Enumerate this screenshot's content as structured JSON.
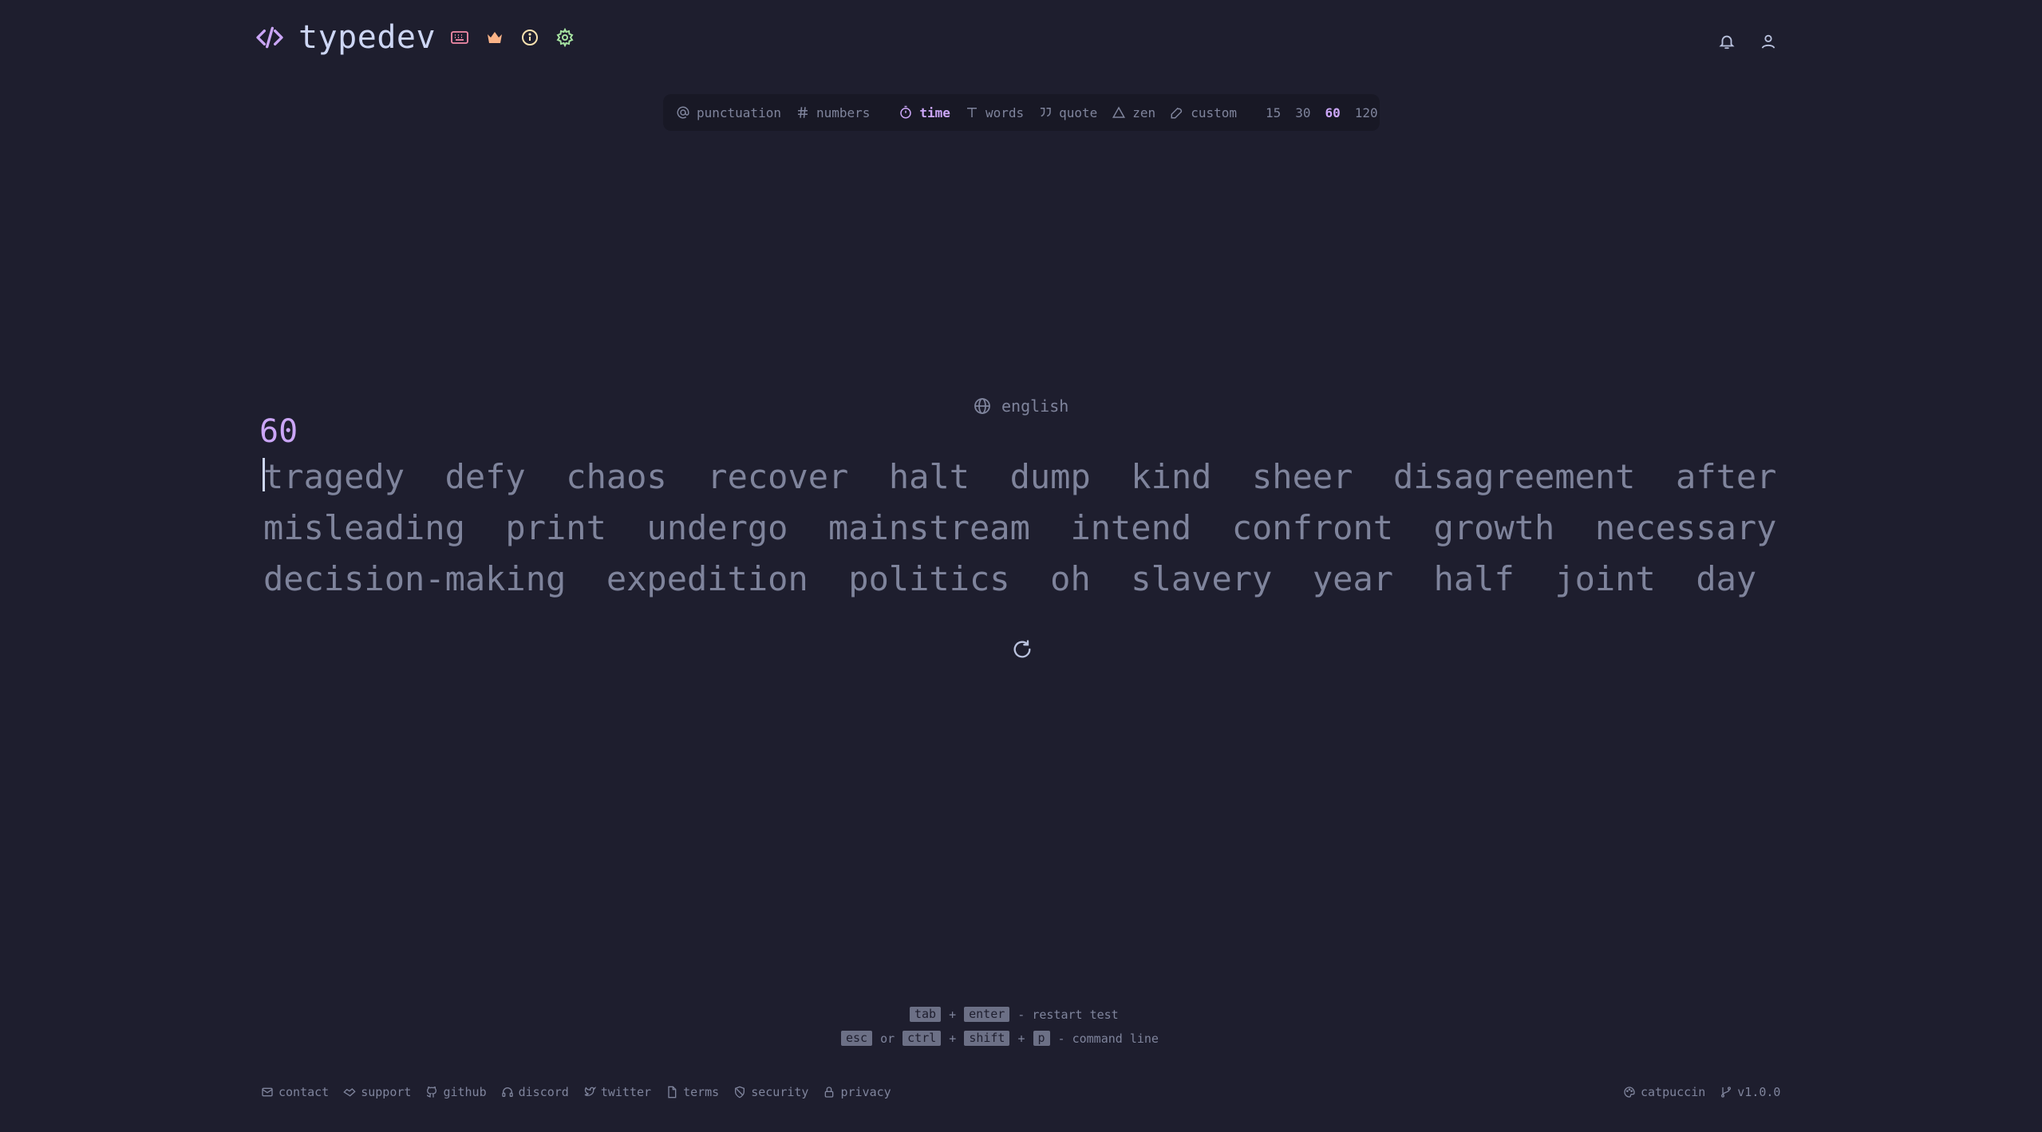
{
  "header": {
    "title": "typedev",
    "icons": [
      "code-icon",
      "keyboard-icon",
      "crown-icon",
      "info-icon",
      "gear-icon",
      "bell-icon",
      "user-icon"
    ]
  },
  "config": {
    "punctuation": "punctuation",
    "numbers": "numbers",
    "modes": [
      "time",
      "words",
      "quote",
      "zen",
      "custom"
    ],
    "active_mode": "time",
    "durations": [
      "15",
      "30",
      "60",
      "120"
    ],
    "active_duration": "60"
  },
  "test": {
    "language": "english",
    "timer": "60",
    "lines": [
      "tragedy  defy  chaos  recover  halt  dump  kind  sheer  disagreement  after",
      "misleading  print  undergo  mainstream  intend  confront  growth  necessary",
      "decision-making  expedition  politics  oh  slavery  year  half  joint  day"
    ]
  },
  "hints": {
    "tab": "tab",
    "plus": "+",
    "enter": "enter",
    "restart_label": "- restart test",
    "esc": "esc",
    "or": "or",
    "ctrl": "ctrl",
    "shift": "shift",
    "p": "p",
    "command_label": "- command line"
  },
  "footer": {
    "links": [
      "contact",
      "support",
      "github",
      "discord",
      "twitter",
      "terms",
      "security",
      "privacy"
    ],
    "theme": "catpuccin",
    "version": "v1.0.0"
  },
  "colors": {
    "background": "#1e1e2e",
    "accent": "#cba6f7",
    "text": "#7f849c",
    "keyboard_icon": "#f38ba8",
    "crown_icon": "#fab387",
    "info_icon": "#f9e2af",
    "gear_icon": "#a6e3a1"
  }
}
